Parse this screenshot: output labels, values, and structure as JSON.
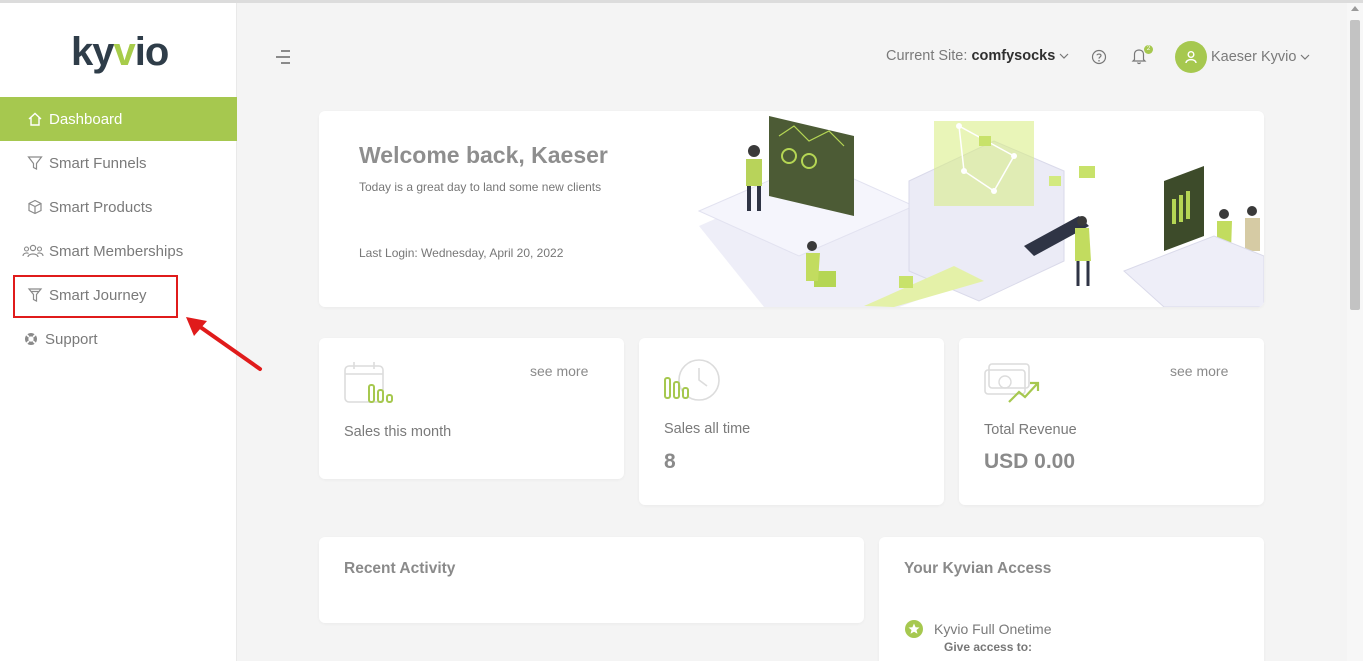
{
  "brand": {
    "logo_text_left": "ky",
    "logo_text_accent": "v",
    "logo_text_right": "io",
    "accent_color": "#a6c84f"
  },
  "sidebar": {
    "items": [
      {
        "label": "Dashboard",
        "icon": "home-icon",
        "active": true
      },
      {
        "label": "Smart Funnels",
        "icon": "funnel-icon"
      },
      {
        "label": "Smart Products",
        "icon": "box-icon"
      },
      {
        "label": "Smart Memberships",
        "icon": "users-icon"
      },
      {
        "label": "Smart Journey",
        "icon": "journey-funnel-icon"
      },
      {
        "label": "Support",
        "icon": "lifebuoy-icon"
      }
    ]
  },
  "topbar": {
    "site_label": "Current Site:",
    "site_value": "comfysocks",
    "notification_count": "2",
    "user_name": "Kaeser Kyvio"
  },
  "welcome": {
    "title": "Welcome back, Kaeser",
    "subtitle": "Today is a great day to land some new clients",
    "last_login": "Last Login: Wednesday, April 20, 2022"
  },
  "stats": [
    {
      "label": "Sales this month",
      "value": "",
      "see_more": "see more"
    },
    {
      "label": "Sales all time",
      "value": "8",
      "see_more": ""
    },
    {
      "label": "Total Revenue",
      "value": "USD 0.00",
      "see_more": "see more"
    }
  ],
  "recent_activity": {
    "title": "Recent Activity"
  },
  "access": {
    "title": "Your Kyvian Access",
    "item": "Kyvio Full Onetime",
    "sub": "Give access to:"
  }
}
